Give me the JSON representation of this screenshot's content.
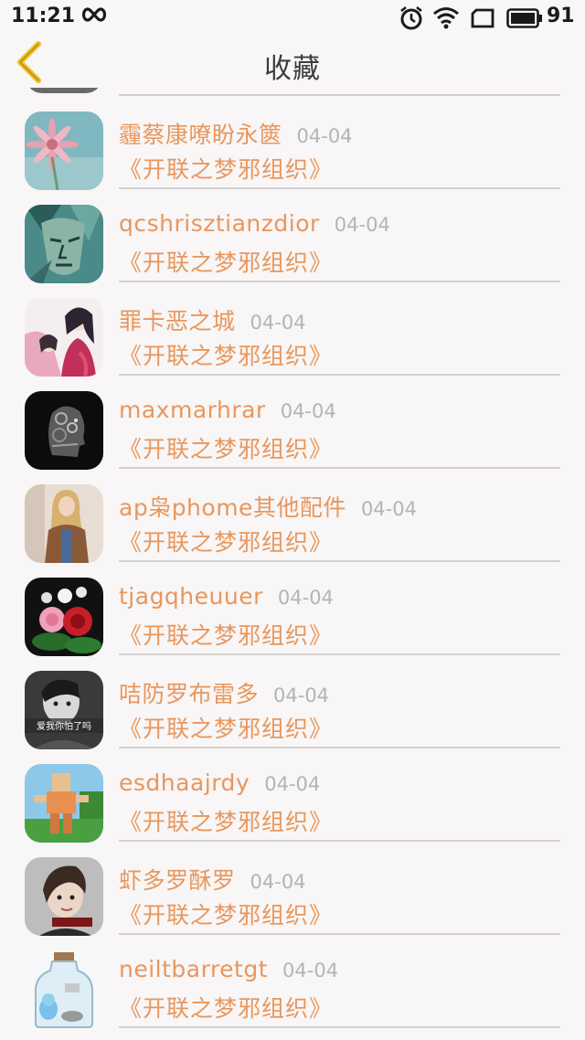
{
  "status_bar": {
    "time": "11:21",
    "battery_level": "91"
  },
  "header": {
    "title": "收藏"
  },
  "favorites": [
    {
      "name": "霾蔡康嘹盼永篋",
      "date": "04-04",
      "topic": "《开联之梦邪组织》",
      "avatar_icon": "flower-avatar-icon"
    },
    {
      "name": "qcshrisztianzdior",
      "date": "04-04",
      "topic": "《开联之梦邪组织》",
      "avatar_icon": "art-face-avatar-icon"
    },
    {
      "name": "罪卡恶之城",
      "date": "04-04",
      "topic": "《开联之梦邪组织》",
      "avatar_icon": "anime-couple-avatar-icon"
    },
    {
      "name": "maxmarhrar",
      "date": "04-04",
      "topic": "《开联之梦邪组织》",
      "avatar_icon": "mechanical-head-avatar-icon"
    },
    {
      "name": "ap枭phome其他配件",
      "date": "04-04",
      "topic": "《开联之梦邪组织》",
      "avatar_icon": "blonde-woman-avatar-icon"
    },
    {
      "name": "tjagqheuuer",
      "date": "04-04",
      "topic": "《开联之梦邪组织》",
      "avatar_icon": "roses-avatar-icon"
    },
    {
      "name": "咭防罗布雷多",
      "date": "04-04",
      "topic": "《开联之梦邪组织》",
      "avatar_icon": "bw-portrait-avatar-icon",
      "avatar_caption": "爱我你怕了吗"
    },
    {
      "name": "esdhaajrdy",
      "date": "04-04",
      "topic": "《开联之梦邪组织》",
      "avatar_icon": "pixel-figure-avatar-icon"
    },
    {
      "name": "虾多罗酥罗",
      "date": "04-04",
      "topic": "《开联之梦邪组织》",
      "avatar_icon": "young-man-avatar-icon"
    },
    {
      "name": "neiltbarretgt",
      "date": "04-04",
      "topic": "《开联之梦邪组织》",
      "avatar_icon": "bottle-avatar-icon"
    }
  ],
  "colors": {
    "accent": "#e8975d",
    "date": "#b4b4b4",
    "divider": "#d4d0d0",
    "background": "#f8f6f6",
    "back_arrow": "#f0c020"
  }
}
